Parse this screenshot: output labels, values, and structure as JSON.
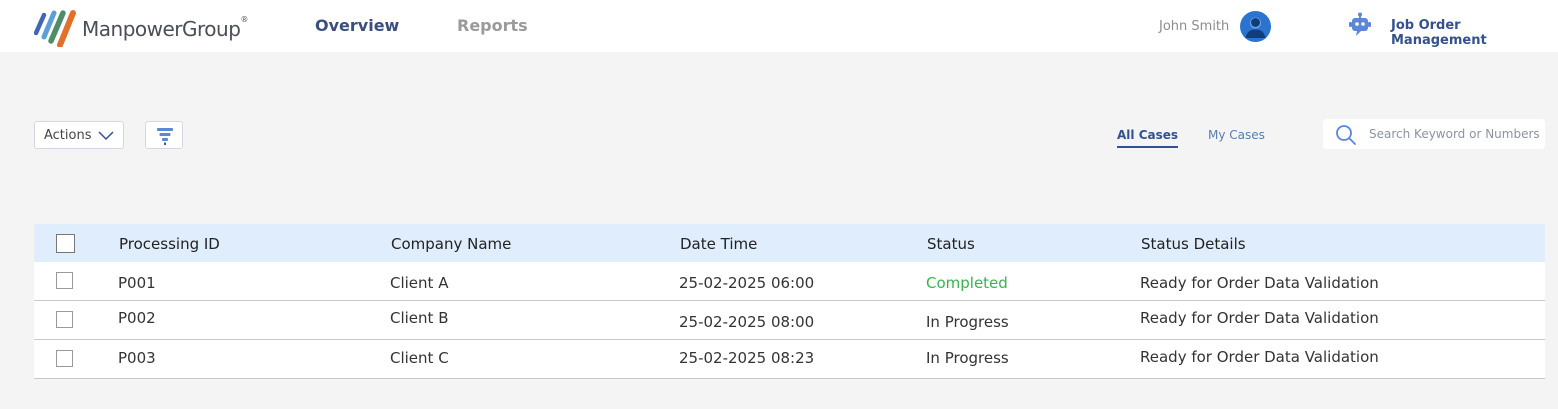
{
  "header": {
    "logo_text": "ManpowerGroup",
    "logo_mark": "®",
    "nav": [
      {
        "label": "Overview",
        "active": true
      },
      {
        "label": "Reports",
        "active": false
      }
    ],
    "user_name": "John Smith",
    "avatar_icon": "user-avatar-icon",
    "app_icon": "robot-icon",
    "app_title": "Job Order Management"
  },
  "toolbar": {
    "actions_label": "Actions",
    "actions_icon": "chevron-down-icon",
    "filter_icon": "funnel-filter-icon",
    "tabs": [
      {
        "label": "All Cases",
        "active": true
      },
      {
        "label": "My Cases",
        "active": false
      }
    ],
    "search": {
      "icon": "search-icon",
      "placeholder": "Search Keyword or Numbers",
      "value": ""
    }
  },
  "table": {
    "columns": [
      "Processing ID",
      "Company Name",
      "Date Time",
      "Status",
      "Status Details"
    ],
    "rows": [
      {
        "id": "P001",
        "company": "Client A",
        "datetime": "25-02-2025 06:00",
        "status": "Completed",
        "details": "Ready for Order Data Validation"
      },
      {
        "id": "P002",
        "company": "Client B",
        "datetime": "25-02-2025 08:00",
        "status": "In Progress",
        "details": "Ready for Order Data Validation"
      },
      {
        "id": "P003",
        "company": "Client C",
        "datetime": "25-02-2025 08:23",
        "status": "In Progress",
        "details": "Ready for Order Data Validation"
      }
    ]
  },
  "colors": {
    "accent": "#34518f",
    "header_row": "#dfedfc",
    "completed": "#38b34d",
    "avatar": "#2a74cf"
  }
}
